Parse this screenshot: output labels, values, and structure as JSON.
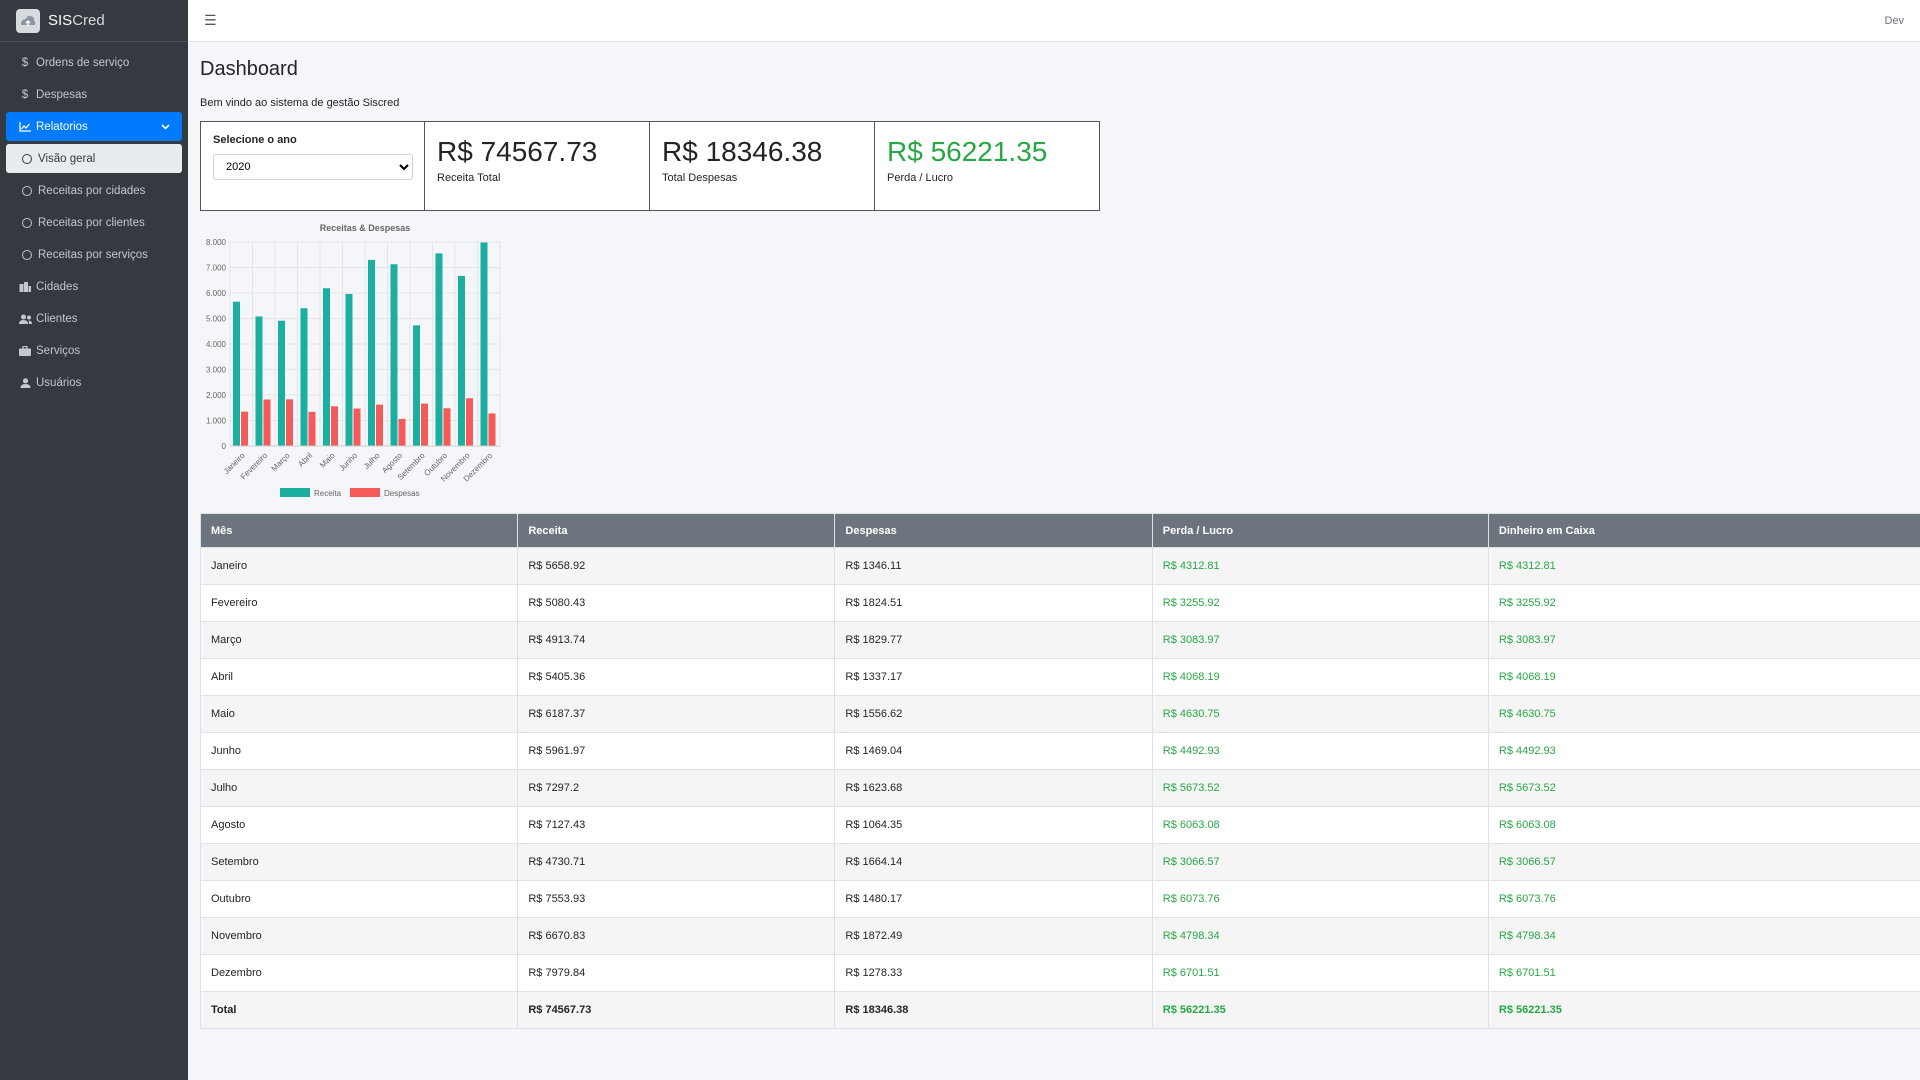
{
  "brand": {
    "name_bold": "SIS",
    "name_rest": "Cred"
  },
  "topbar": {
    "user": "Dev"
  },
  "sidebar": {
    "items": [
      {
        "label": "Ordens de serviço",
        "icon": "dollar-icon"
      },
      {
        "label": "Despesas",
        "icon": "dollar-icon"
      },
      {
        "label": "Relatorios",
        "icon": "chart-icon",
        "active": true
      },
      {
        "label": "Cidades",
        "icon": "building-icon"
      },
      {
        "label": "Clientes",
        "icon": "users-icon"
      },
      {
        "label": "Serviços",
        "icon": "briefcase-icon"
      },
      {
        "label": "Usuários",
        "icon": "user-icon"
      }
    ],
    "sub_items": [
      {
        "label": "Visão geral",
        "selected": true
      },
      {
        "label": "Receitas por cidades"
      },
      {
        "label": "Receitas por clientes"
      },
      {
        "label": "Receitas por serviços"
      }
    ]
  },
  "page": {
    "title": "Dashboard",
    "welcome": "Bem vindo ao sistema de gestão Siscred"
  },
  "year_select": {
    "label": "Selecione o ano",
    "value": "2020"
  },
  "cards": [
    {
      "value": "R$ 74567.73",
      "label": "Receita Total"
    },
    {
      "value": "R$ 18346.38",
      "label": "Total Despesas"
    },
    {
      "value": "R$ 56221.35",
      "label": "Perda / Lucro"
    }
  ],
  "colors": {
    "receita": "#1aaf9f",
    "despesas": "#f55a5a",
    "green": "#28a745",
    "accent": "#007bff"
  },
  "chart_data": {
    "type": "bar",
    "title": "Receitas & Despesas",
    "categories": [
      "Janeiro",
      "Fevereiro",
      "Março",
      "Abril",
      "Maio",
      "Junho",
      "Julho",
      "Agosto",
      "Setembro",
      "Outubro",
      "Novembro",
      "Dezembro"
    ],
    "series": [
      {
        "name": "Receita",
        "values": [
          5658.92,
          5080.43,
          4913.74,
          5405.36,
          6187.37,
          5961.97,
          7297.2,
          7127.43,
          4730.71,
          7553.93,
          6670.83,
          7979.84
        ]
      },
      {
        "name": "Despesas",
        "values": [
          1346.11,
          1824.51,
          1829.77,
          1337.17,
          1556.62,
          1469.04,
          1623.68,
          1064.35,
          1664.14,
          1480.17,
          1872.49,
          1278.33
        ]
      }
    ],
    "ylim": [
      0,
      8000
    ],
    "yticks": [
      "0",
      "1.000",
      "2.000",
      "3.000",
      "4.000",
      "5.000",
      "6.000",
      "7.000",
      "8.000"
    ],
    "legend": "bottom",
    "grid": true
  },
  "table": {
    "headers": [
      "Mês",
      "Receita",
      "Despesas",
      "Perda / Lucro",
      "Dinheiro em Caixa"
    ],
    "rows": [
      [
        "Janeiro",
        "R$ 5658.92",
        "R$ 1346.11",
        "R$ 4312.81",
        "R$ 4312.81"
      ],
      [
        "Fevereiro",
        "R$ 5080.43",
        "R$ 1824.51",
        "R$ 3255.92",
        "R$ 3255.92"
      ],
      [
        "Março",
        "R$ 4913.74",
        "R$ 1829.77",
        "R$ 3083.97",
        "R$ 3083.97"
      ],
      [
        "Abril",
        "R$ 5405.36",
        "R$ 1337.17",
        "R$ 4068.19",
        "R$ 4068.19"
      ],
      [
        "Maio",
        "R$ 6187.37",
        "R$ 1556.62",
        "R$ 4630.75",
        "R$ 4630.75"
      ],
      [
        "Junho",
        "R$ 5961.97",
        "R$ 1469.04",
        "R$ 4492.93",
        "R$ 4492.93"
      ],
      [
        "Julho",
        "R$ 7297.2",
        "R$ 1623.68",
        "R$ 5673.52",
        "R$ 5673.52"
      ],
      [
        "Agosto",
        "R$ 7127.43",
        "R$ 1064.35",
        "R$ 6063.08",
        "R$ 6063.08"
      ],
      [
        "Setembro",
        "R$ 4730.71",
        "R$ 1664.14",
        "R$ 3066.57",
        "R$ 3066.57"
      ],
      [
        "Outubro",
        "R$ 7553.93",
        "R$ 1480.17",
        "R$ 6073.76",
        "R$ 6073.76"
      ],
      [
        "Novembro",
        "R$ 6670.83",
        "R$ 1872.49",
        "R$ 4798.34",
        "R$ 4798.34"
      ],
      [
        "Dezembro",
        "R$ 7979.84",
        "R$ 1278.33",
        "R$ 6701.51",
        "R$ 6701.51"
      ]
    ],
    "total": [
      "Total",
      "R$ 74567.73",
      "R$ 18346.38",
      "R$ 56221.35",
      "R$ 56221.35"
    ]
  }
}
